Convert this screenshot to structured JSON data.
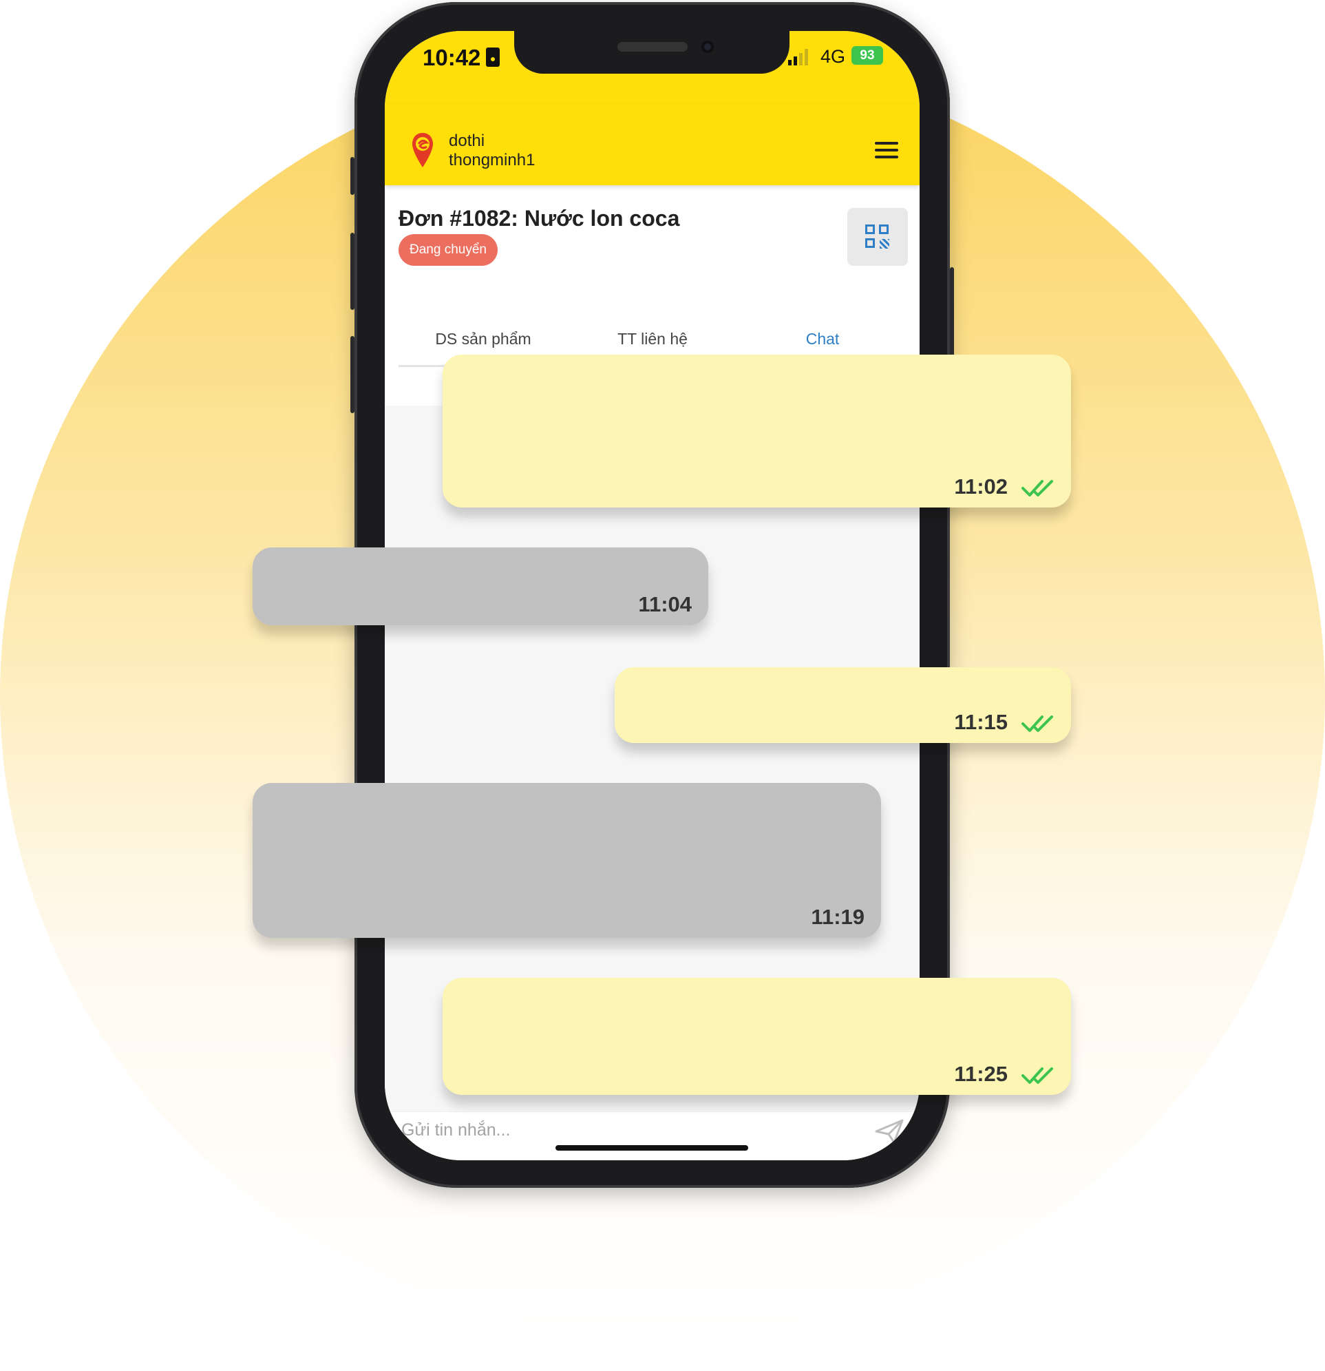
{
  "status_bar": {
    "time": "10:42",
    "network": "4G",
    "battery": "93"
  },
  "app": {
    "brand_line1": "dothi",
    "brand_line2": "thongminh1"
  },
  "order": {
    "title": "Đơn #1082: Nước lon coca",
    "status": "Đang chuyển"
  },
  "tabs": [
    {
      "label": "DS sản phẩm",
      "active": false
    },
    {
      "label": "TT liên hệ",
      "active": false
    },
    {
      "label": "Chat",
      "active": true
    }
  ],
  "messages": [
    {
      "direction": "out",
      "time": "11:02",
      "read": true
    },
    {
      "direction": "in",
      "time": "11:04"
    },
    {
      "direction": "out",
      "time": "11:15",
      "read": true
    },
    {
      "direction": "in",
      "time": "11:19"
    },
    {
      "direction": "out",
      "time": "11:25",
      "read": true
    }
  ],
  "composer": {
    "placeholder": "Gửi tin nhắn..."
  },
  "colors": {
    "header": "#ffde0a",
    "accent": "#2e7ec8",
    "badge": "#ec6e5e",
    "outgoing_bubble": "#fcf5b3",
    "incoming_bubble": "#c1c1c1",
    "check": "#3cc44e"
  }
}
